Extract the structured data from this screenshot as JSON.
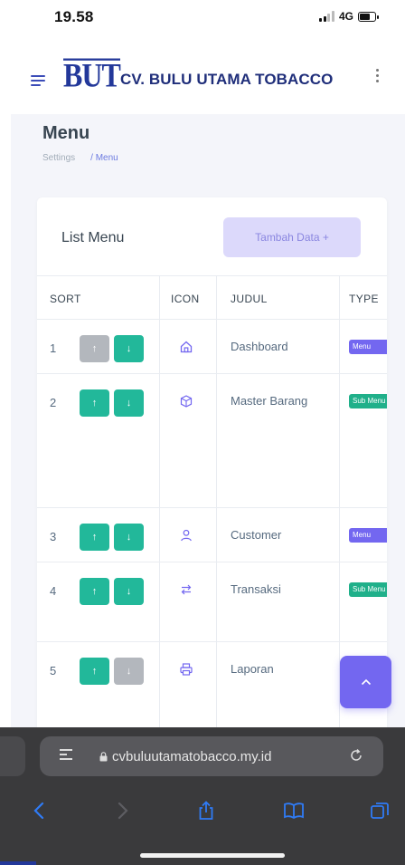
{
  "status_bar": {
    "time": "19.58",
    "network": "4G"
  },
  "header": {
    "logo_text": "BUT",
    "brand_name": "CV. BULU UTAMA TOBACCO"
  },
  "page": {
    "title": "Menu",
    "breadcrumb": [
      {
        "label": "Settings"
      },
      {
        "label": "/ Menu"
      }
    ]
  },
  "card": {
    "title": "List Menu",
    "add_button_label": "Tambah Data +",
    "columns": [
      "SORT",
      "ICON",
      "JUDUL",
      "TYPE"
    ],
    "rows": [
      {
        "num": "1",
        "judul": "Dashboard",
        "icon": "home-icon",
        "type": "Menu",
        "up_enabled": false,
        "down_enabled": true
      },
      {
        "num": "2",
        "judul": "Master Barang",
        "icon": "box-icon",
        "type": "Sub Menu",
        "up_enabled": true,
        "down_enabled": true
      },
      {
        "num": "3",
        "judul": "Customer",
        "icon": "user-icon",
        "type": "Menu",
        "up_enabled": true,
        "down_enabled": true
      },
      {
        "num": "4",
        "judul": "Transaksi",
        "icon": "transfer-icon",
        "type": "Sub Menu",
        "up_enabled": true,
        "down_enabled": true
      },
      {
        "num": "5",
        "judul": "Laporan",
        "icon": "printer-icon",
        "type": "",
        "up_enabled": true,
        "down_enabled": false
      }
    ],
    "sort_up_glyph": "↑",
    "sort_down_glyph": "↓"
  },
  "browser": {
    "url": "cvbuluutamatobacco.my.id"
  },
  "colors": {
    "primary": "#7367f0",
    "success": "#22b89a",
    "disabled": "#b3b7bd",
    "brand": "#23389a"
  }
}
